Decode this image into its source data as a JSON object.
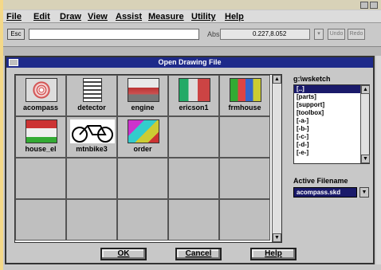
{
  "menubar": {
    "items": [
      "File",
      "Edit",
      "Draw",
      "View",
      "Assist",
      "Measure",
      "Utility",
      "Help"
    ]
  },
  "commandbar": {
    "esc_label": "Esc",
    "abs_label": "Abs",
    "coordinates": "0.227,8.052",
    "undo_label": "Undo",
    "redo_label": "Redo"
  },
  "dialog": {
    "title": "Open Drawing File",
    "files": [
      {
        "name": "acompass",
        "icon": "compass-thumbnail"
      },
      {
        "name": "detector",
        "icon": "detector-thumbnail"
      },
      {
        "name": "engine",
        "icon": "engine-thumbnail"
      },
      {
        "name": "ericson1",
        "icon": "ericson-thumbnail"
      },
      {
        "name": "frmhouse",
        "icon": "farmhouse-thumbnail"
      },
      {
        "name": "house_el",
        "icon": "house-elevation-thumbnail"
      },
      {
        "name": "mtnbike3",
        "icon": "bicycle-thumbnail"
      },
      {
        "name": "order",
        "icon": "order-thumbnail"
      }
    ],
    "directory_label": "g:\\wsketch",
    "directories": [
      "[..]",
      "[parts]",
      "[support]",
      "[toolbox]",
      "[-a-]",
      "[-b-]",
      "[-c-]",
      "[-d-]",
      "[-e-]"
    ],
    "selected_directory_index": 0,
    "active_filename_label": "Active Filename",
    "active_filename": "acompass.skd",
    "buttons": {
      "ok": "OK",
      "cancel": "Cancel",
      "help": "Help"
    }
  },
  "colors": {
    "title_bar": "#1e2a8a",
    "selection": "#1a1a6a",
    "desk_background": "#f4d888"
  }
}
